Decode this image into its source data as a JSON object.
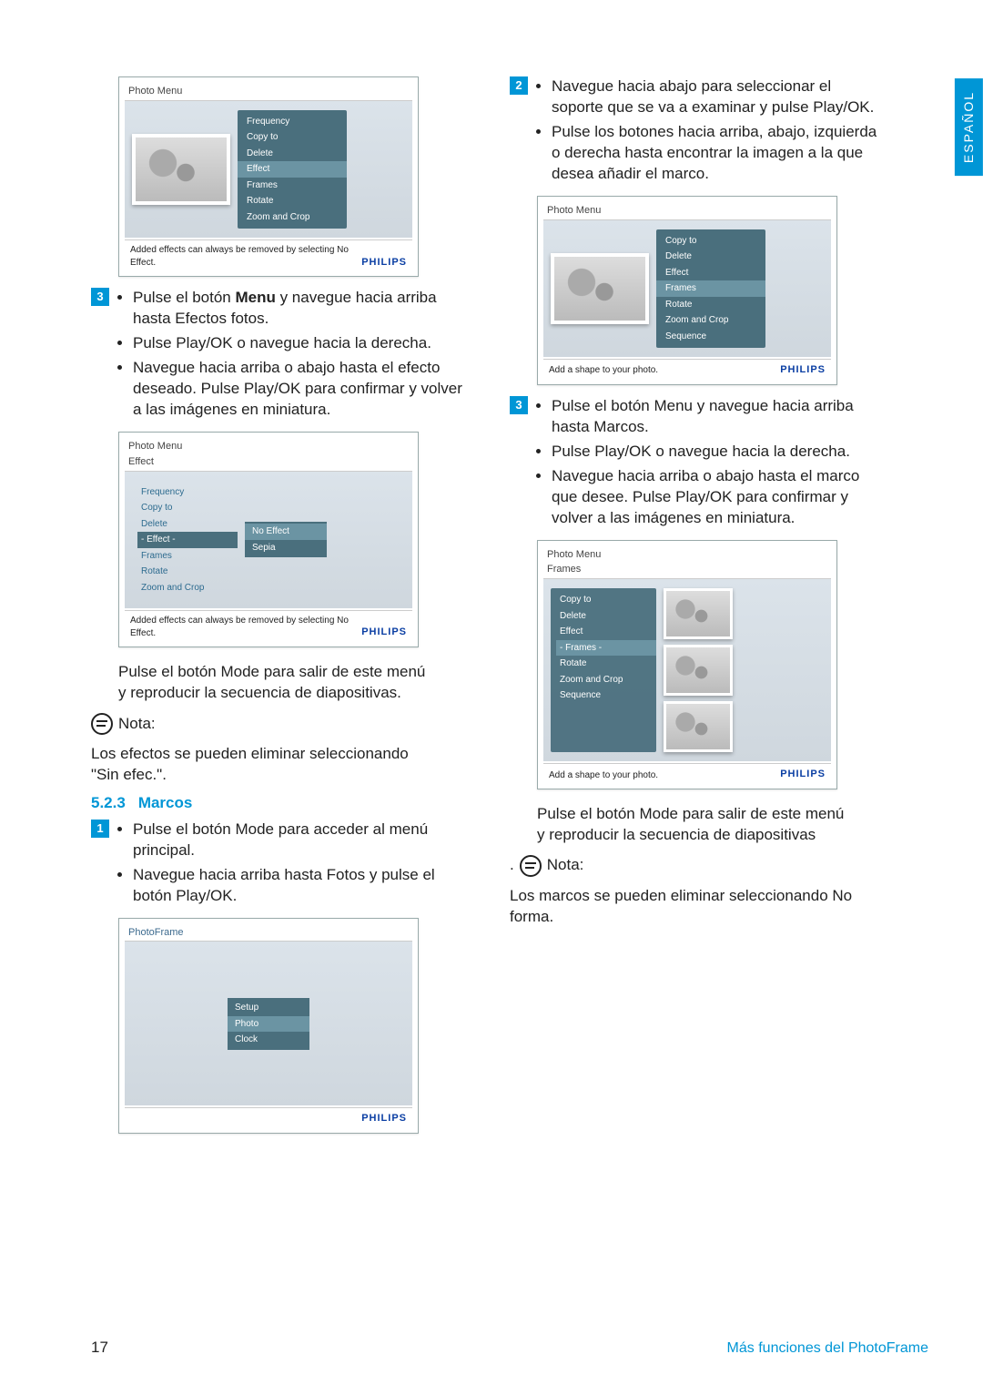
{
  "lang_tab": "ESPAÑOL",
  "page_number": "17",
  "footer_section": "Más funciones del PhotoFrame",
  "philips": "PHILIPS",
  "left": {
    "ss1": {
      "title": "Photo Menu",
      "menu": [
        "Frequency",
        "Copy to",
        "Delete",
        "Effect",
        "Frames",
        "Rotate",
        "Zoom and Crop"
      ],
      "highlight": "Effect",
      "note": "Added effects can always be removed by selecting No Effect."
    },
    "step3": {
      "num": "3",
      "b1_a": "Pulse el botón ",
      "b1_bold": "Menu",
      "b1_b": " y navegue hacia arriba hasta Efectos fotos.",
      "b2": "Pulse Play/OK o navegue hacia la derecha.",
      "b3": "Navegue hacia arriba o abajo hasta el efecto deseado. Pulse Play/OK para confirmar y volver a las imágenes en miniatura."
    },
    "ss2": {
      "title": "Photo Menu",
      "sub": "Effect",
      "side": [
        "Frequency",
        "Copy to",
        "Delete",
        "- Effect -",
        "Frames",
        "Rotate",
        "Zoom and Crop"
      ],
      "side_hl": "- Effect -",
      "popup": [
        "No Effect",
        "Sepia"
      ],
      "popup_hl": "No Effect",
      "note": "Added effects can always be removed by selecting No Effect."
    },
    "para1": "Pulse el botón Mode para salir de este menú y reproducir la secuencia de diapositivas.",
    "note_label": "Nota:",
    "note_text": "Los efectos se pueden eliminar seleccionando \"Sin efec.\".",
    "heading_num": "5.2.3",
    "heading_text": "Marcos",
    "step1": {
      "num": "1",
      "b1": "Pulse el botón Mode para acceder al menú principal.",
      "b2": "Navegue hacia arriba hasta Fotos y pulse el botón Play/OK."
    },
    "ss3": {
      "title": "PhotoFrame",
      "popup": [
        "Setup",
        "Photo",
        "Clock"
      ],
      "popup_hl": "Photo"
    }
  },
  "right": {
    "step2": {
      "num": "2",
      "b1": "Navegue hacia abajo para seleccionar el soporte que se va a examinar y pulse Play/OK.",
      "b2": "Pulse los botones hacia arriba, abajo, izquierda o derecha hasta encontrar la imagen a la que desea añadir el marco."
    },
    "ss4": {
      "title": "Photo Menu",
      "menu": [
        "Copy to",
        "Delete",
        "Effect",
        "Frames",
        "Rotate",
        "Zoom and Crop",
        "Sequence"
      ],
      "highlight": "Frames",
      "note": "Add a shape to your photo."
    },
    "step3": {
      "num": "3",
      "b1": "Pulse el botón Menu y navegue hacia arriba hasta Marcos.",
      "b2": "Pulse Play/OK o navegue hacia la derecha.",
      "b3": "Navegue hacia arriba o abajo hasta el marco que desee. Pulse Play/OK para confirmar y volver a las imágenes en miniatura."
    },
    "ss5": {
      "title": "Photo Menu",
      "sub": "Frames",
      "side": [
        "Copy to",
        "Delete",
        "Effect",
        "- Frames -",
        "Rotate",
        "Zoom and Crop",
        "Sequence"
      ],
      "side_hl": "- Frames -",
      "note": "Add a shape to your photo."
    },
    "para1": "Pulse el botón Mode para salir de este menú y reproducir la secuencia de diapositivas",
    "note_label": "Nota:",
    "note_text": "Los marcos se pueden eliminar seleccionando No forma."
  }
}
